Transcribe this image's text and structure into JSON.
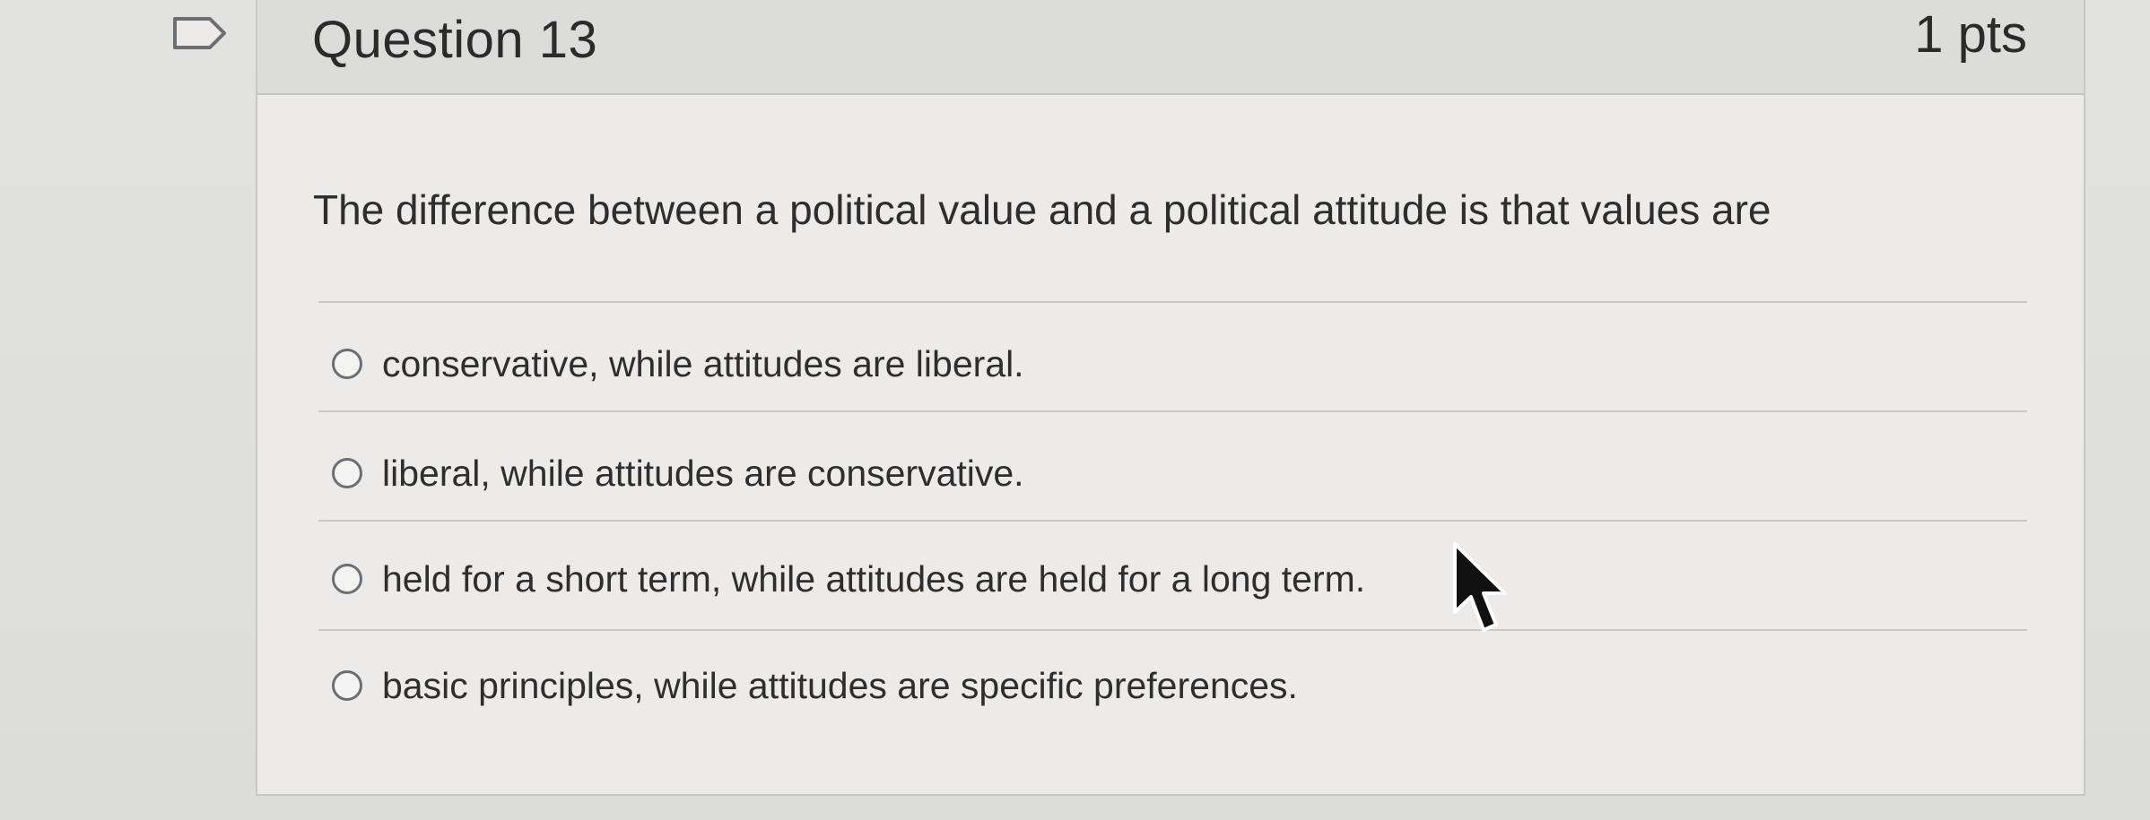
{
  "question": {
    "title": "Question 13",
    "points": "1 pts",
    "text": "The difference between a political value and a political attitude is that values are",
    "answers": [
      {
        "label": "conservative, while attitudes are liberal."
      },
      {
        "label": "liberal, while attitudes are conservative."
      },
      {
        "label": "held for a short term, while attitudes are held for a long term."
      },
      {
        "label": "basic principles, while attitudes are specific preferences."
      }
    ]
  },
  "icons": {
    "flag": "flag-outline-icon",
    "cursor": "mouse-pointer-icon"
  },
  "colors": {
    "background": "#dfdfdd",
    "card": "#ecebe9",
    "header": "#dcdcda",
    "text": "#2e2e2e",
    "radio_border": "#6c6f72"
  }
}
